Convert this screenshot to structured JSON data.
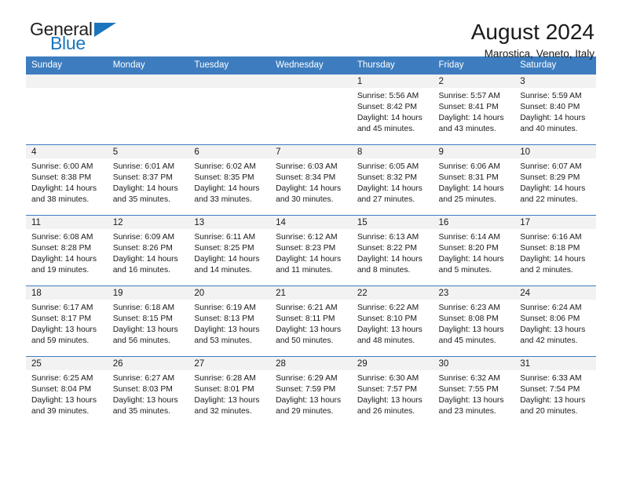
{
  "brand": {
    "name_top": "General",
    "name_bottom": "Blue",
    "accent_color": "#1b75bc",
    "triangle_icon": "brand-triangle-icon"
  },
  "header": {
    "title": "August 2024",
    "subtitle": "Marostica, Veneto, Italy"
  },
  "theme": {
    "header_row_bg": "#3d7dbf",
    "header_row_text": "#ffffff",
    "daynum_band_bg": "#f2f2f2",
    "cell_border": "#3d7dbf",
    "body_text": "#1a1a1a"
  },
  "weekday_headers": [
    "Sunday",
    "Monday",
    "Tuesday",
    "Wednesday",
    "Thursday",
    "Friday",
    "Saturday"
  ],
  "labels": {
    "sunrise_prefix": "Sunrise:",
    "sunset_prefix": "Sunset:",
    "daylight_prefix": "Daylight:"
  },
  "weeks": [
    [
      {
        "day": "",
        "line1": "",
        "line2": "",
        "line3": "",
        "line4": ""
      },
      {
        "day": "",
        "line1": "",
        "line2": "",
        "line3": "",
        "line4": ""
      },
      {
        "day": "",
        "line1": "",
        "line2": "",
        "line3": "",
        "line4": ""
      },
      {
        "day": "",
        "line1": "",
        "line2": "",
        "line3": "",
        "line4": ""
      },
      {
        "day": "1",
        "line1": "Sunrise: 5:56 AM",
        "line2": "Sunset: 8:42 PM",
        "line3": "Daylight: 14 hours",
        "line4": "and 45 minutes."
      },
      {
        "day": "2",
        "line1": "Sunrise: 5:57 AM",
        "line2": "Sunset: 8:41 PM",
        "line3": "Daylight: 14 hours",
        "line4": "and 43 minutes."
      },
      {
        "day": "3",
        "line1": "Sunrise: 5:59 AM",
        "line2": "Sunset: 8:40 PM",
        "line3": "Daylight: 14 hours",
        "line4": "and 40 minutes."
      }
    ],
    [
      {
        "day": "4",
        "line1": "Sunrise: 6:00 AM",
        "line2": "Sunset: 8:38 PM",
        "line3": "Daylight: 14 hours",
        "line4": "and 38 minutes."
      },
      {
        "day": "5",
        "line1": "Sunrise: 6:01 AM",
        "line2": "Sunset: 8:37 PM",
        "line3": "Daylight: 14 hours",
        "line4": "and 35 minutes."
      },
      {
        "day": "6",
        "line1": "Sunrise: 6:02 AM",
        "line2": "Sunset: 8:35 PM",
        "line3": "Daylight: 14 hours",
        "line4": "and 33 minutes."
      },
      {
        "day": "7",
        "line1": "Sunrise: 6:03 AM",
        "line2": "Sunset: 8:34 PM",
        "line3": "Daylight: 14 hours",
        "line4": "and 30 minutes."
      },
      {
        "day": "8",
        "line1": "Sunrise: 6:05 AM",
        "line2": "Sunset: 8:32 PM",
        "line3": "Daylight: 14 hours",
        "line4": "and 27 minutes."
      },
      {
        "day": "9",
        "line1": "Sunrise: 6:06 AM",
        "line2": "Sunset: 8:31 PM",
        "line3": "Daylight: 14 hours",
        "line4": "and 25 minutes."
      },
      {
        "day": "10",
        "line1": "Sunrise: 6:07 AM",
        "line2": "Sunset: 8:29 PM",
        "line3": "Daylight: 14 hours",
        "line4": "and 22 minutes."
      }
    ],
    [
      {
        "day": "11",
        "line1": "Sunrise: 6:08 AM",
        "line2": "Sunset: 8:28 PM",
        "line3": "Daylight: 14 hours",
        "line4": "and 19 minutes."
      },
      {
        "day": "12",
        "line1": "Sunrise: 6:09 AM",
        "line2": "Sunset: 8:26 PM",
        "line3": "Daylight: 14 hours",
        "line4": "and 16 minutes."
      },
      {
        "day": "13",
        "line1": "Sunrise: 6:11 AM",
        "line2": "Sunset: 8:25 PM",
        "line3": "Daylight: 14 hours",
        "line4": "and 14 minutes."
      },
      {
        "day": "14",
        "line1": "Sunrise: 6:12 AM",
        "line2": "Sunset: 8:23 PM",
        "line3": "Daylight: 14 hours",
        "line4": "and 11 minutes."
      },
      {
        "day": "15",
        "line1": "Sunrise: 6:13 AM",
        "line2": "Sunset: 8:22 PM",
        "line3": "Daylight: 14 hours",
        "line4": "and 8 minutes."
      },
      {
        "day": "16",
        "line1": "Sunrise: 6:14 AM",
        "line2": "Sunset: 8:20 PM",
        "line3": "Daylight: 14 hours",
        "line4": "and 5 minutes."
      },
      {
        "day": "17",
        "line1": "Sunrise: 6:16 AM",
        "line2": "Sunset: 8:18 PM",
        "line3": "Daylight: 14 hours",
        "line4": "and 2 minutes."
      }
    ],
    [
      {
        "day": "18",
        "line1": "Sunrise: 6:17 AM",
        "line2": "Sunset: 8:17 PM",
        "line3": "Daylight: 13 hours",
        "line4": "and 59 minutes."
      },
      {
        "day": "19",
        "line1": "Sunrise: 6:18 AM",
        "line2": "Sunset: 8:15 PM",
        "line3": "Daylight: 13 hours",
        "line4": "and 56 minutes."
      },
      {
        "day": "20",
        "line1": "Sunrise: 6:19 AM",
        "line2": "Sunset: 8:13 PM",
        "line3": "Daylight: 13 hours",
        "line4": "and 53 minutes."
      },
      {
        "day": "21",
        "line1": "Sunrise: 6:21 AM",
        "line2": "Sunset: 8:11 PM",
        "line3": "Daylight: 13 hours",
        "line4": "and 50 minutes."
      },
      {
        "day": "22",
        "line1": "Sunrise: 6:22 AM",
        "line2": "Sunset: 8:10 PM",
        "line3": "Daylight: 13 hours",
        "line4": "and 48 minutes."
      },
      {
        "day": "23",
        "line1": "Sunrise: 6:23 AM",
        "line2": "Sunset: 8:08 PM",
        "line3": "Daylight: 13 hours",
        "line4": "and 45 minutes."
      },
      {
        "day": "24",
        "line1": "Sunrise: 6:24 AM",
        "line2": "Sunset: 8:06 PM",
        "line3": "Daylight: 13 hours",
        "line4": "and 42 minutes."
      }
    ],
    [
      {
        "day": "25",
        "line1": "Sunrise: 6:25 AM",
        "line2": "Sunset: 8:04 PM",
        "line3": "Daylight: 13 hours",
        "line4": "and 39 minutes."
      },
      {
        "day": "26",
        "line1": "Sunrise: 6:27 AM",
        "line2": "Sunset: 8:03 PM",
        "line3": "Daylight: 13 hours",
        "line4": "and 35 minutes."
      },
      {
        "day": "27",
        "line1": "Sunrise: 6:28 AM",
        "line2": "Sunset: 8:01 PM",
        "line3": "Daylight: 13 hours",
        "line4": "and 32 minutes."
      },
      {
        "day": "28",
        "line1": "Sunrise: 6:29 AM",
        "line2": "Sunset: 7:59 PM",
        "line3": "Daylight: 13 hours",
        "line4": "and 29 minutes."
      },
      {
        "day": "29",
        "line1": "Sunrise: 6:30 AM",
        "line2": "Sunset: 7:57 PM",
        "line3": "Daylight: 13 hours",
        "line4": "and 26 minutes."
      },
      {
        "day": "30",
        "line1": "Sunrise: 6:32 AM",
        "line2": "Sunset: 7:55 PM",
        "line3": "Daylight: 13 hours",
        "line4": "and 23 minutes."
      },
      {
        "day": "31",
        "line1": "Sunrise: 6:33 AM",
        "line2": "Sunset: 7:54 PM",
        "line3": "Daylight: 13 hours",
        "line4": "and 20 minutes."
      }
    ]
  ]
}
